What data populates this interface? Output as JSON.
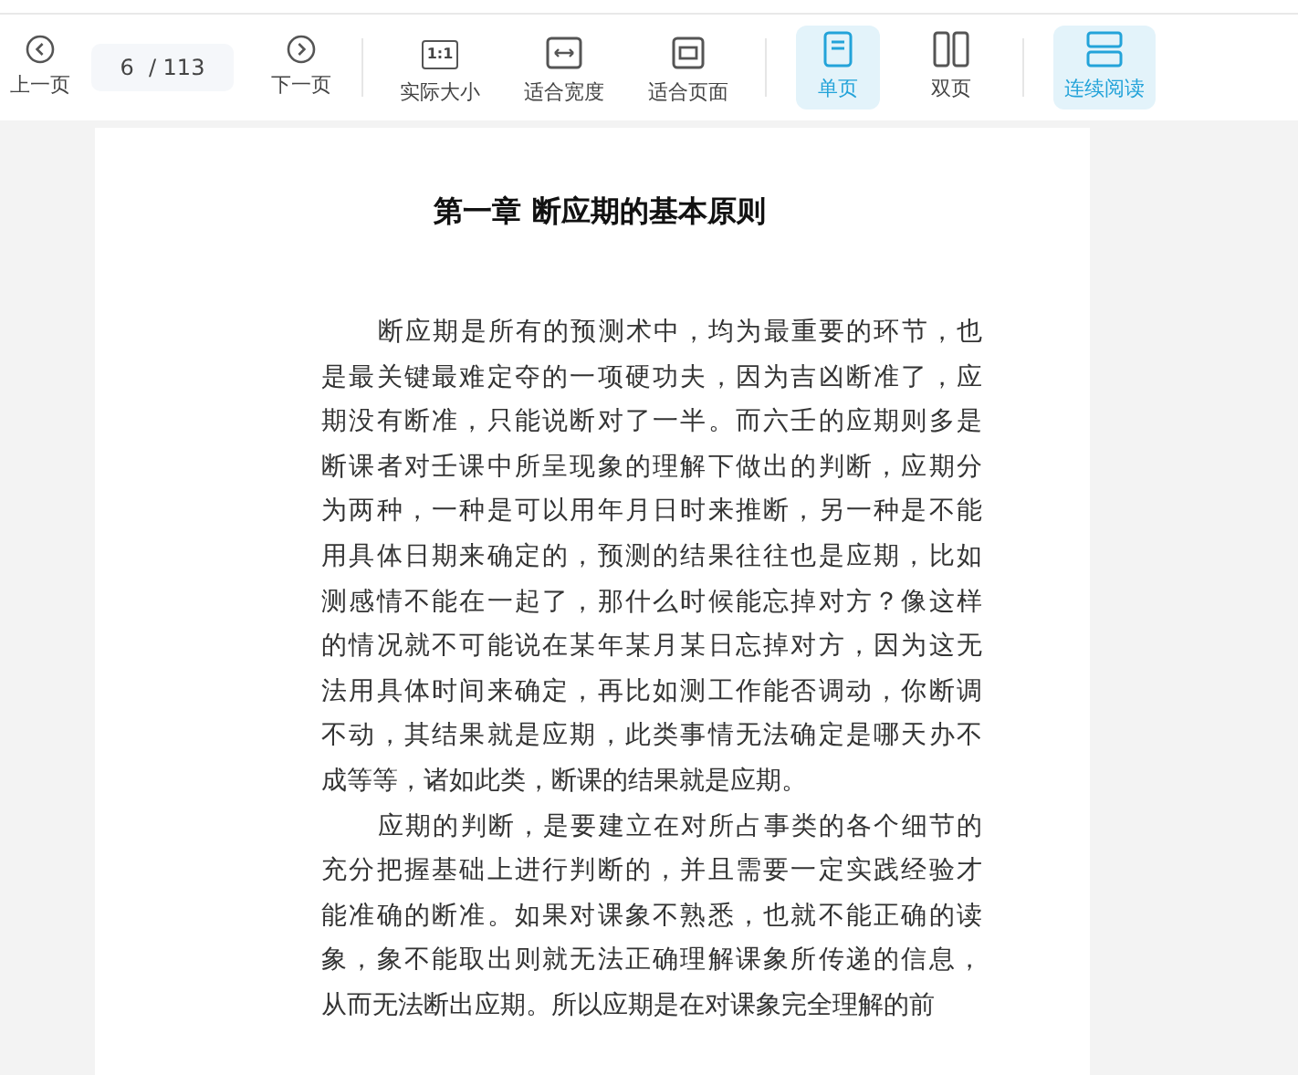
{
  "toolbar": {
    "prev": {
      "label": "上一页"
    },
    "page_field": {
      "value": "6",
      "total": "/ 113"
    },
    "next": {
      "label": "下一页"
    },
    "zoom_buttons": [
      {
        "kind": "actual",
        "label": "实际大小",
        "icon_text": "1:1"
      },
      {
        "kind": "width",
        "label": "适合宽度"
      },
      {
        "kind": "page",
        "label": "适合页面"
      }
    ],
    "view_buttons": [
      {
        "kind": "single",
        "label": "单页",
        "selected": true
      },
      {
        "kind": "double",
        "label": "双页",
        "selected": false
      },
      {
        "kind": "continuous",
        "label": "连续阅读",
        "selected": true
      }
    ]
  },
  "document": {
    "title": "第一章  断应期的基本原则",
    "paragraphs": [
      {
        "lines": [
          "断应期是所有的预测术中，均为最重要的环节，也",
          "是最关键最难定夺的一项硬功夫，因为吉凶断准了，应",
          "期没有断准，只能说断对了一半。而六壬的应期则多是",
          "断课者对壬课中所呈现象的理解下做出的判断，应期分",
          "为两种，一种是可以用年月日时来推断，另一种是不能",
          "用具体日期来确定的，预测的结果往往也是应期，比如",
          "测感情不能在一起了，那什么时候能忘掉对方？像这样",
          "的情况就不可能说在某年某月某日忘掉对方，因为这无",
          "法用具体时间来确定，再比如测工作能否调动，你断调",
          "不动，其结果就是应期，此类事情无法确定是哪天办不",
          "成等等，诸如此类，断课的结果就是应期。"
        ]
      },
      {
        "lines": [
          "应期的判断，是要建立在对所占事类的各个细节的",
          "充分把握基础上进行判断的，并且需要一定实践经验才",
          "能准确的断准。如果对课象不熟悉，也就不能正确的读",
          "象，象不能取出则就无法正确理解课象所传递的信息，",
          "从而无法断出应期。所以应期是在对课象完全理解的前"
        ]
      }
    ]
  }
}
